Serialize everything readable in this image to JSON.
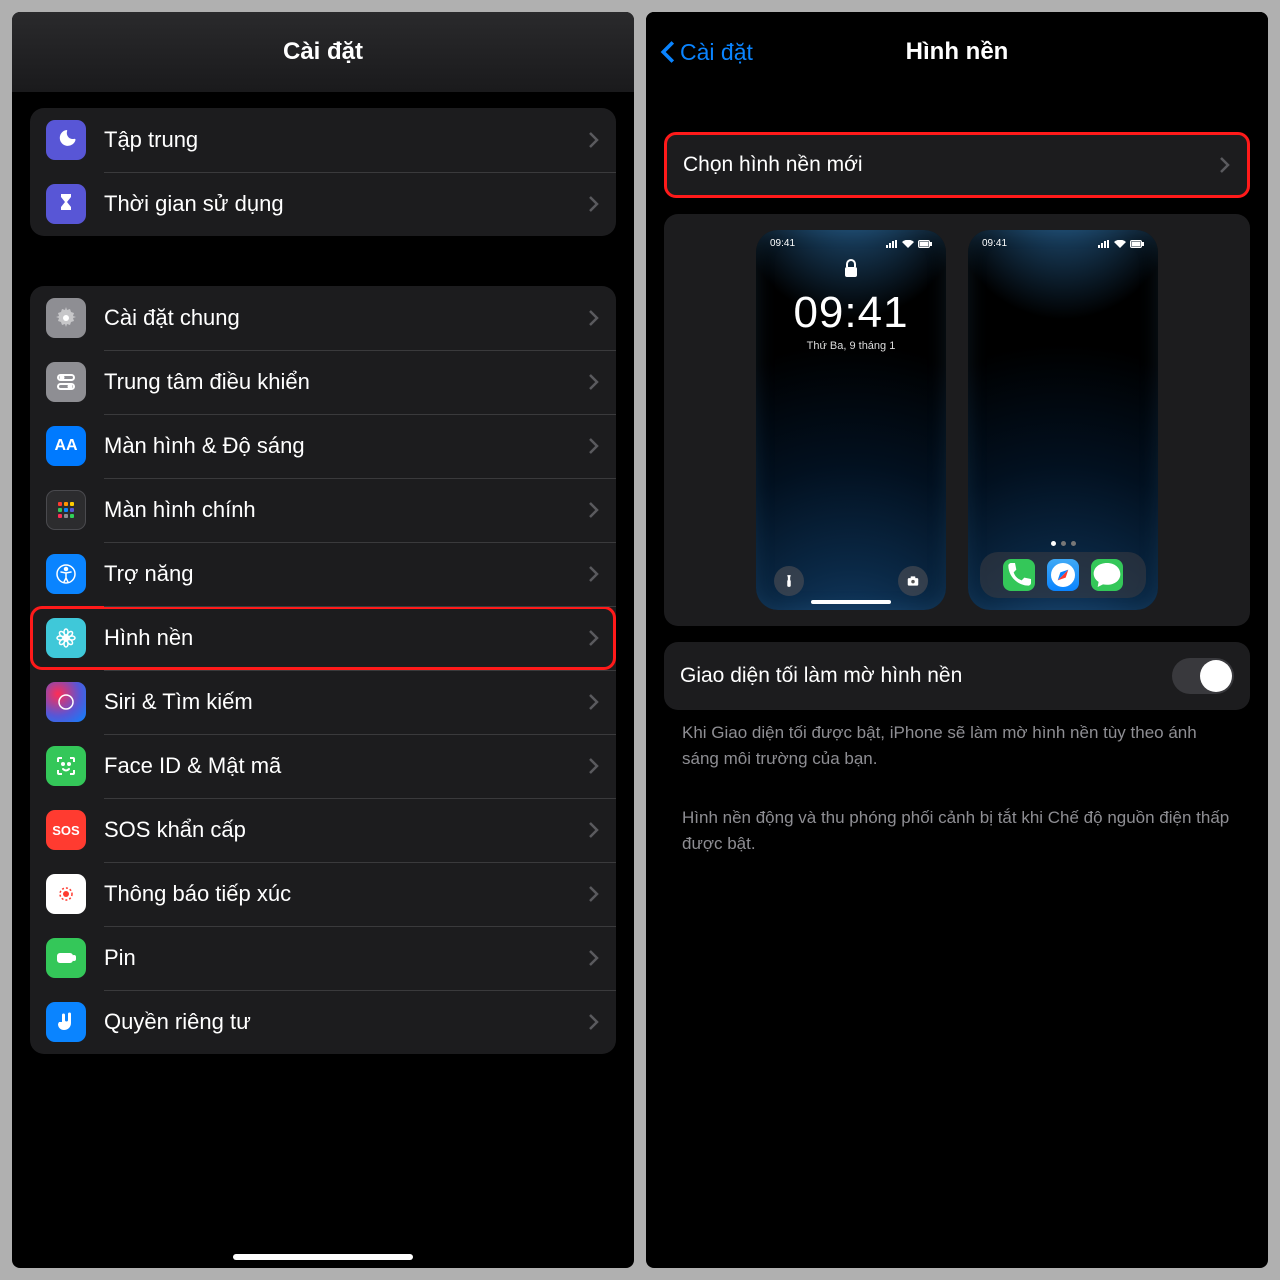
{
  "left": {
    "title": "Cài đặt",
    "group1": [
      {
        "label": "Tập trung",
        "icon": "moon",
        "bg": "bg-indigo"
      },
      {
        "label": "Thời gian sử dụng",
        "icon": "hourglass",
        "bg": "bg-indigo"
      }
    ],
    "group2": [
      {
        "label": "Cài đặt chung",
        "icon": "gear",
        "bg": "bg-gray"
      },
      {
        "label": "Trung tâm điều khiển",
        "icon": "switches",
        "bg": "bg-gray2"
      },
      {
        "label": "Màn hình & Độ sáng",
        "icon": "aa",
        "bg": "bg-blue"
      },
      {
        "label": "Màn hình chính",
        "icon": "grid",
        "bg": "bg-dark"
      },
      {
        "label": "Trợ năng",
        "icon": "accessibility",
        "bg": "bg-blue2"
      },
      {
        "label": "Hình nền",
        "icon": "flower",
        "bg": "bg-cyan",
        "highlight": true
      },
      {
        "label": "Siri & Tìm kiếm",
        "icon": "siri",
        "bg": "bg-gradient"
      },
      {
        "label": "Face ID & Mật mã",
        "icon": "face",
        "bg": "bg-green"
      },
      {
        "label": "SOS khẩn cấp",
        "icon": "sos",
        "bg": "bg-red"
      },
      {
        "label": "Thông báo tiếp xúc",
        "icon": "exposure",
        "bg": "bg-white"
      },
      {
        "label": "Pin",
        "icon": "battery",
        "bg": "bg-green"
      },
      {
        "label": "Quyền riêng tư",
        "icon": "hand",
        "bg": "bg-blue2"
      }
    ]
  },
  "right": {
    "back": "Cài đặt",
    "title": "Hình nền",
    "choose": "Chọn hình nền mới",
    "lock_time": "09:41",
    "lock_date": "Thứ Ba, 9 tháng 1",
    "status_time": "09:41",
    "toggle_label": "Giao diện tối làm mờ hình nền",
    "note1": "Khi Giao diện tối được bật, iPhone sẽ làm mờ hình nền tùy theo ánh sáng môi trường của bạn.",
    "note2": "Hình nền động và thu phóng phối cảnh bị tắt khi Chế độ nguồn điện thấp được bật."
  }
}
